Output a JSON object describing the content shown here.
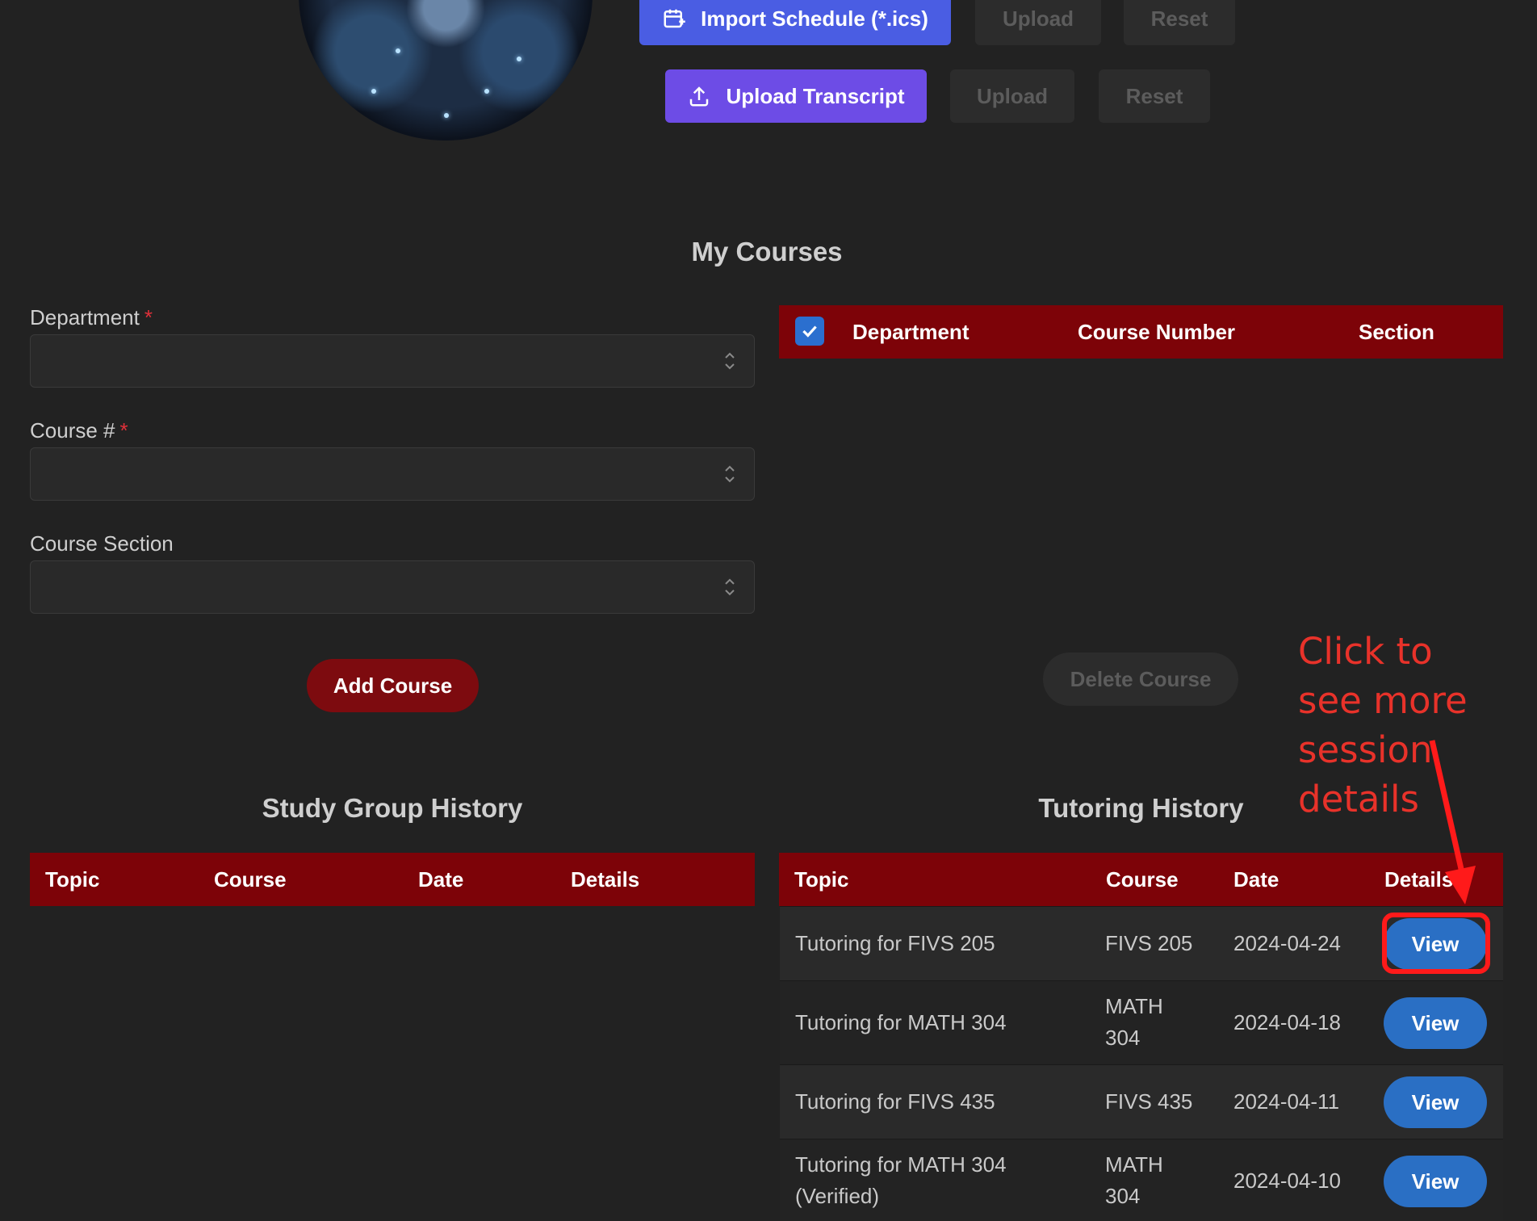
{
  "toolbar": {
    "import_schedule_label": "Import Schedule (*.ics)",
    "upload_label_1": "Upload",
    "reset_label_1": "Reset",
    "upload_transcript_label": "Upload Transcript",
    "upload_label_2": "Upload",
    "reset_label_2": "Reset"
  },
  "my_courses": {
    "title": "My Courses",
    "form": {
      "department_label": "Department",
      "course_number_label": "Course #",
      "course_section_label": "Course Section",
      "required_mark": "*",
      "department_value": "",
      "course_number_value": "",
      "course_section_value": "",
      "add_course_label": "Add Course"
    },
    "table": {
      "columns": [
        "Department",
        "Course Number",
        "Section"
      ],
      "rows": [],
      "delete_course_label": "Delete Course"
    }
  },
  "study_group_history": {
    "title": "Study Group History",
    "columns": [
      "Topic",
      "Course",
      "Date",
      "Details"
    ],
    "rows": []
  },
  "tutoring_history": {
    "title": "Tutoring History",
    "columns": [
      "Topic",
      "Course",
      "Date",
      "Details"
    ],
    "rows": [
      {
        "topic": "Tutoring for FIVS 205",
        "topic2": "",
        "course": "FIVS 205",
        "course2": "",
        "date": "2024-04-24",
        "action": "View"
      },
      {
        "topic": "Tutoring for MATH 304",
        "topic2": "",
        "course": "MATH",
        "course2": "304",
        "date": "2024-04-18",
        "action": "View"
      },
      {
        "topic": "Tutoring for FIVS 435",
        "topic2": "",
        "course": "FIVS 435",
        "course2": "",
        "date": "2024-04-11",
        "action": "View"
      },
      {
        "topic": "Tutoring for MATH 304",
        "topic2": "(Verified)",
        "course": "MATH",
        "course2": "304",
        "date": "2024-04-10",
        "action": "View"
      }
    ]
  },
  "annotation": {
    "lines": [
      "Click to",
      "see more",
      "session",
      "details"
    ]
  },
  "colors": {
    "header_red": "#7d0308",
    "annotation_red": "#e8322a",
    "view_blue": "#2a6fc4",
    "import_blue": "#4a5de3",
    "transcript_violet": "#6d4ce6"
  },
  "icons": {
    "import_schedule": "calendar-plus-icon",
    "upload_transcript": "upload-icon",
    "select_chevron": "chevron-up-down-icon",
    "checkbox": "check-icon"
  }
}
